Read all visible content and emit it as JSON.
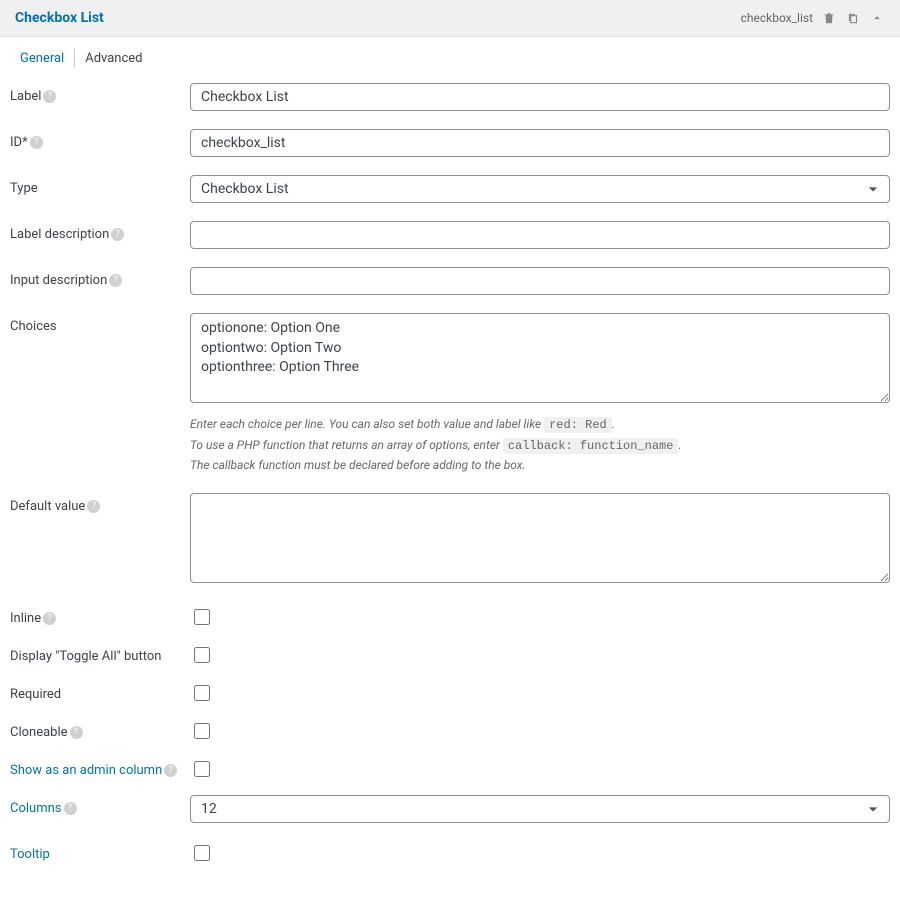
{
  "header": {
    "title": "Checkbox List",
    "id_display": "checkbox_list"
  },
  "tabs": {
    "general": "General",
    "advanced": "Advanced"
  },
  "labels": {
    "label": "Label",
    "id": "ID*",
    "type": "Type",
    "label_description": "Label description",
    "input_description": "Input description",
    "choices": "Choices",
    "default_value": "Default value",
    "inline": "Inline",
    "toggle_all": "Display \"Toggle All\" button",
    "required": "Required",
    "cloneable": "Cloneable",
    "admin_column": "Show as an admin column",
    "columns": "Columns",
    "tooltip": "Tooltip"
  },
  "values": {
    "label": "Checkbox List",
    "id": "checkbox_list",
    "type": "Checkbox List",
    "label_description": "",
    "input_description": "",
    "choices": "optionone: Option One\noptiontwo: Option Two\noptionthree: Option Three",
    "default_value": "",
    "columns": "12"
  },
  "hints": {
    "choices_line1_a": "Enter each choice per line. You can also set both value and label like ",
    "choices_line1_code": "red: Red",
    "choices_line1_b": ".",
    "choices_line2_a": "To use a PHP function that returns an array of options, enter ",
    "choices_line2_code": "callback: function_name",
    "choices_line2_b": ".",
    "choices_line3": "The callback function must be declared before adding to the box."
  }
}
